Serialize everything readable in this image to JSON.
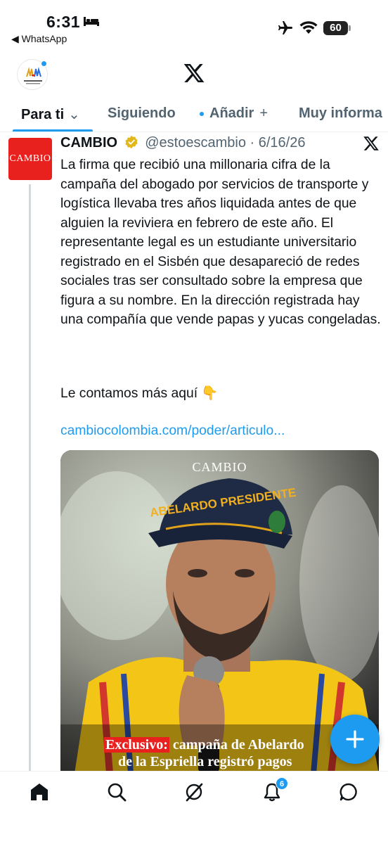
{
  "status": {
    "time": "6:31",
    "back_app": "◀ WhatsApp",
    "battery": "60"
  },
  "header": {
    "avatar_label": "MANOS LIMPIAS"
  },
  "tabs": [
    {
      "label": "Para ti"
    },
    {
      "label": "Siguiendo"
    },
    {
      "label": "Añadir"
    },
    {
      "label": "Muy informa"
    }
  ],
  "tweet": {
    "avatar_text": "CAMBIO",
    "name": "CAMBIO",
    "handle_date": "@estoescambio · 6/16/26",
    "text": "La firma que recibió una millonaria cifra de la campaña del abogado por servicios de transporte y logística llevaba tres años liquidada antes de que alguien la reviviera en febrero de este año. El representante legal es un estudiante universitario registrado en el Sisbén que desapareció de redes sociales tras ser consultado sobre la empresa que figura a su nombre. En la dirección registrada hay una compañía que vende papas y yucas congeladas.",
    "text2": "Le contamos más aquí 👇",
    "link": "cambiocolombia.com/poder/articulo...",
    "media": {
      "brand": "CAMBIO",
      "cap_text": "ABELARDO PRESIDENTE",
      "caption_tag": "Exclusivo:",
      "caption_rest": " campaña de Abelardo",
      "caption_line2": "de la Espriella registró pagos"
    }
  },
  "nav": {
    "notifications_badge": "6"
  },
  "colors": {
    "accent": "#1d9bf0",
    "brand_red": "#e8211e",
    "text": "#0f1419",
    "muted": "#536471"
  }
}
